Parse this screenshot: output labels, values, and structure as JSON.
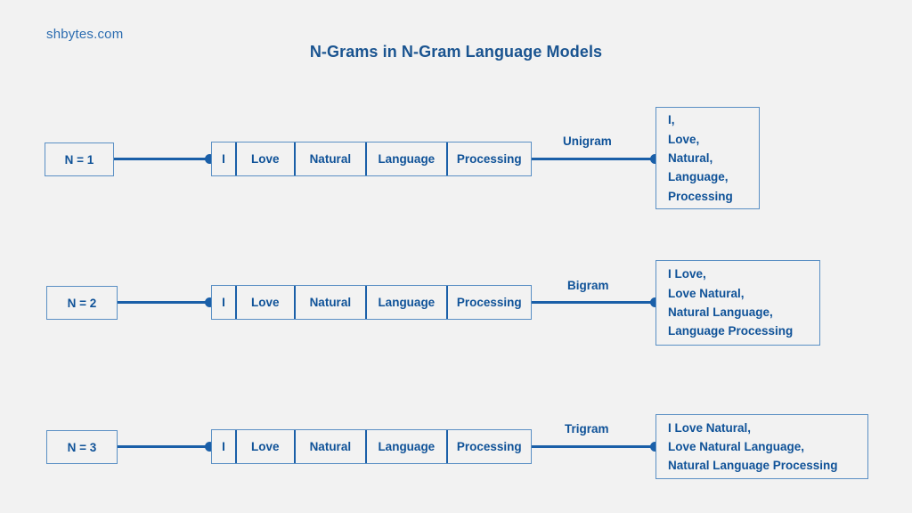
{
  "watermark": "shbytes.com",
  "title": "N-Grams in N-Gram Language Models",
  "colors": {
    "background": "#f2f2f2",
    "accent": "#0f5298",
    "line": "#1a5fa8",
    "border": "#5a8fc4",
    "title": "#1a5490",
    "watermark": "#2b6cb0"
  },
  "sentence_words": [
    "I",
    "Love",
    "Natural",
    "Language",
    "Processing"
  ],
  "rows": [
    {
      "n_label": "N = 1",
      "words": [
        "I",
        "Love",
        "Natural",
        "Language",
        "Processing"
      ],
      "gram_label": "Unigram",
      "result_lines": [
        "I,",
        "Love,",
        "Natural,",
        "Language,",
        "Processing"
      ]
    },
    {
      "n_label": "N = 2",
      "words": [
        "I",
        "Love",
        "Natural",
        "Language",
        "Processing"
      ],
      "gram_label": "Bigram",
      "result_lines": [
        "I Love,",
        "Love Natural,",
        "Natural Language,",
        "Language Processing"
      ]
    },
    {
      "n_label": "N = 3",
      "words": [
        "I",
        "Love",
        "Natural",
        "Language",
        "Processing"
      ],
      "gram_label": "Trigram",
      "result_lines": [
        "I Love Natural,",
        "Love Natural Language,",
        "Natural Language Processing"
      ]
    }
  ]
}
